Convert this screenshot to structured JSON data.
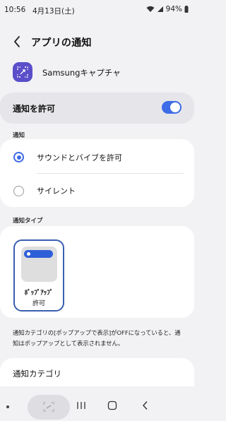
{
  "status_bar": {
    "time": "10:56",
    "date": "4月13日(土)",
    "battery": "94%",
    "icons": [
      "wifi-icon",
      "signal-icon",
      "battery-icon"
    ]
  },
  "header": {
    "back_icon": "chevron-left-icon",
    "title": "アプリの通知"
  },
  "app": {
    "name": "Samsungキャプチャ",
    "icon": "capture-icon",
    "icon_color": "#5a4fc9"
  },
  "allow_notifications": {
    "label": "通知を許可",
    "enabled": true,
    "accent": "#3e6be6"
  },
  "notification_section": {
    "header": "通知",
    "options": [
      {
        "label": "サウンドとバイブを許可",
        "selected": true
      },
      {
        "label": "サイレント",
        "selected": false
      }
    ]
  },
  "notification_type": {
    "header": "通知タイプ",
    "option": {
      "label_line1": "ﾎﾟｯﾌﾟｱｯﾌﾟ",
      "label_line2": "許可",
      "selected": true
    }
  },
  "description": "通知カテゴリの[ポップアップで表示]がOFFになっていると、通知はポップアップとして表示されません。",
  "category": {
    "label": "通知カテゴリ"
  },
  "nav_bar": {
    "buttons": [
      "recents-icon",
      "home-icon",
      "back-icon"
    ]
  }
}
